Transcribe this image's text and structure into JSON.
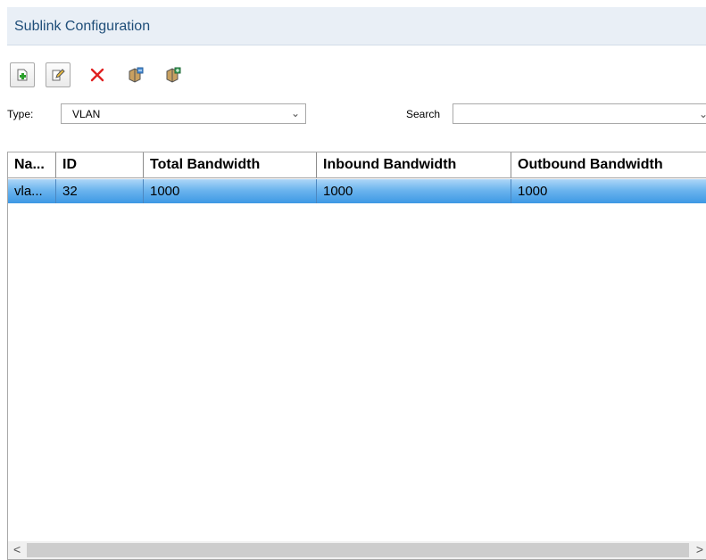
{
  "panel": {
    "title": "Sublink Configuration"
  },
  "toolbar": {
    "buttons": [
      {
        "icon": "add-icon"
      },
      {
        "icon": "edit-icon"
      },
      {
        "icon": "delete-icon"
      },
      {
        "icon": "import-icon"
      },
      {
        "icon": "export-icon"
      }
    ]
  },
  "filter": {
    "type_label": "Type:",
    "type_value": "VLAN",
    "search_label": "Search",
    "search_value": ""
  },
  "table": {
    "columns": [
      "Na...",
      "ID",
      "Total Bandwidth",
      "Inbound Bandwidth",
      "Outbound Bandwidth"
    ],
    "rows": [
      [
        "vla...",
        "32",
        "1000",
        "1000",
        "1000"
      ]
    ]
  },
  "scrollbar": {
    "left_arrow": "<",
    "right_arrow": ">"
  },
  "colors": {
    "header_bg": "#e9eff6",
    "title": "#1f4e79",
    "selected_row": "#4fa3e8",
    "delete_red": "#e02020"
  }
}
